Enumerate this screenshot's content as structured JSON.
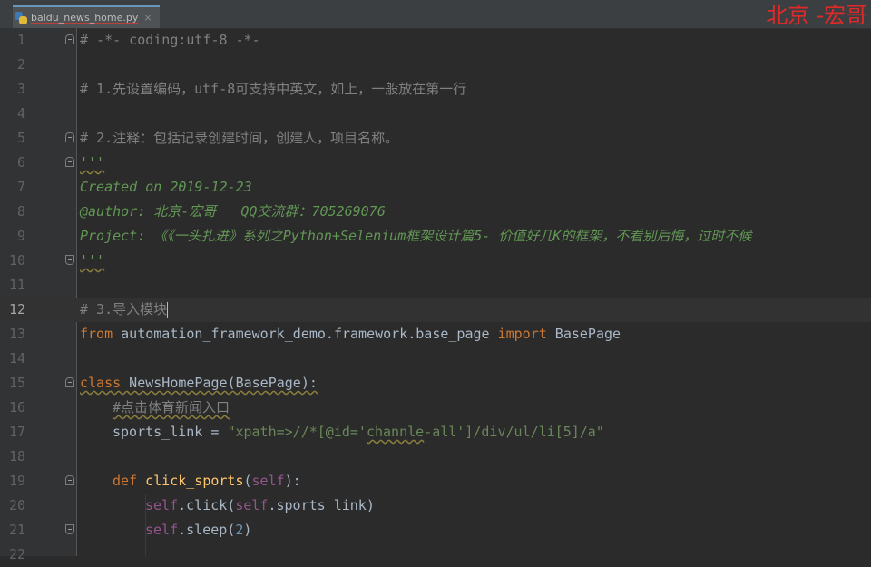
{
  "tab": {
    "file_name": "baidu_news_home.py",
    "close_glyph": "×"
  },
  "watermark": "北京 -宏哥",
  "lines": {
    "n1": "1",
    "n2": "2",
    "n3": "3",
    "n4": "4",
    "n5": "5",
    "n6": "6",
    "n7": "7",
    "n8": "8",
    "n9": "9",
    "n10": "10",
    "n11": "11",
    "n12": "12",
    "n13": "13",
    "n14": "14",
    "n15": "15",
    "n16": "16",
    "n17": "17",
    "n18": "18",
    "n19": "19",
    "n20": "20",
    "n21": "21",
    "n22": "22"
  },
  "code": {
    "l1": "# -*- coding:utf-8 -*-",
    "l3": "# 1.先设置编码，utf-8可支持中英文，如上，一般放在第一行",
    "l5": "# 2.注释：包括记录创建时间，创建人，项目名称。",
    "l6": "'''",
    "l7": "Created on 2019-12-23",
    "l8": "@author: 北京-宏哥   QQ交流群：705269076",
    "l9": "Project: 《《一头扎进》系列之Python+Selenium框架设计篇5- 价值好几K的框架，不看别后悔，过时不候",
    "l10": "'''",
    "l12": "# 3.导入模块",
    "l13": {
      "kw_from": "from",
      "module": " automation_framework_demo.framework.base_page ",
      "kw_import": "import",
      "name": " BasePage"
    },
    "l15": {
      "kw_class": "class",
      "rest": " NewsHomePage(BasePage):"
    },
    "l16": "#点击体育新闻入口",
    "l17": {
      "lhs": "sports_link = ",
      "str_a": "\"xpath=>//*[@id='",
      "str_b": "channle",
      "str_c": "-all']/div/ul/li[5]/a\""
    },
    "l19": {
      "kw_def": "def",
      "fname": "click_sports",
      "open": "(",
      "self": "self",
      "close": "):"
    },
    "l20": {
      "self1": "self",
      "mid": ".click(",
      "self2": "self",
      "end": ".sports_link)"
    },
    "l21": {
      "self1": "self",
      "mid": ".sleep(",
      "num": "2",
      "end": ")"
    }
  },
  "colors": {
    "background": "#2b2b2b",
    "gutter": "#313335",
    "comment": "#808080",
    "docstring": "#629755",
    "keyword": "#cc7832",
    "string": "#6a8759",
    "self": "#94558d",
    "function": "#ffc66d",
    "number": "#6897bb",
    "watermark": "#e02a2a"
  },
  "icons": {
    "tab_file_icon": "python-file-icon"
  }
}
